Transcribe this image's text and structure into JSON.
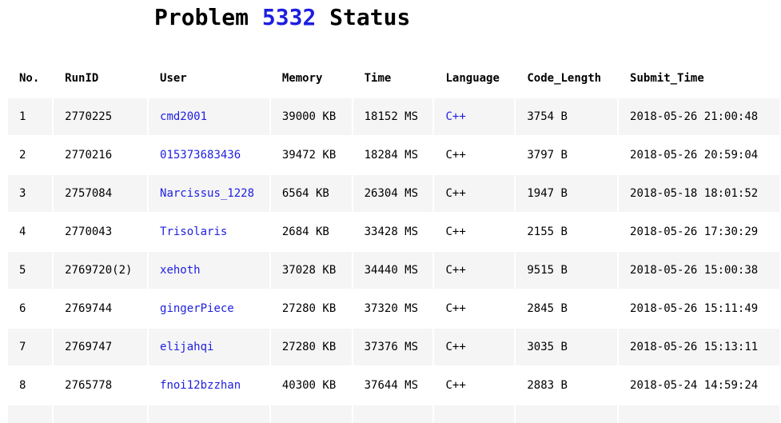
{
  "page": {
    "title_prefix": "Problem",
    "problem_id": "5332",
    "title_suffix": "Status"
  },
  "table": {
    "headers": {
      "no": "No.",
      "run_id": "RunID",
      "user": "User",
      "memory": "Memory",
      "time": "Time",
      "language": "Language",
      "code_length": "Code_Length",
      "submit_time": "Submit_Time"
    },
    "rows": [
      {
        "no": "1",
        "run_id": "2770225",
        "user": "cmd2001",
        "memory": "39000 KB",
        "time": "18152 MS",
        "language": "C++",
        "code_length": "3754 B",
        "submit_time": "2018-05-26 21:00:48"
      },
      {
        "no": "2",
        "run_id": "2770216",
        "user": "015373683436",
        "memory": "39472 KB",
        "time": "18284 MS",
        "language": "C++",
        "code_length": "3797 B",
        "submit_time": "2018-05-26 20:59:04"
      },
      {
        "no": "3",
        "run_id": "2757084",
        "user": "Narcissus_1228",
        "memory": "6564 KB",
        "time": "26304 MS",
        "language": "C++",
        "code_length": "1947 B",
        "submit_time": "2018-05-18 18:01:52"
      },
      {
        "no": "4",
        "run_id": "2770043",
        "user": "Trisolaris",
        "memory": "2684 KB",
        "time": "33428 MS",
        "language": "C++",
        "code_length": "2155 B",
        "submit_time": "2018-05-26 17:30:29"
      },
      {
        "no": "5",
        "run_id": "2769720(2)",
        "user": "xehoth",
        "memory": "37028 KB",
        "time": "34440 MS",
        "language": "C++",
        "code_length": "9515 B",
        "submit_time": "2018-05-26 15:00:38"
      },
      {
        "no": "6",
        "run_id": "2769744",
        "user": "gingerPiece",
        "memory": "27280 KB",
        "time": "37320 MS",
        "language": "C++",
        "code_length": "2845 B",
        "submit_time": "2018-05-26 15:11:49"
      },
      {
        "no": "7",
        "run_id": "2769747",
        "user": "elijahqi",
        "memory": "27280 KB",
        "time": "37376 MS",
        "language": "C++",
        "code_length": "3035 B",
        "submit_time": "2018-05-26 15:13:11"
      },
      {
        "no": "8",
        "run_id": "2765778",
        "user": "fnoi12bzzhan",
        "memory": "40300 KB",
        "time": "37644 MS",
        "language": "C++",
        "code_length": "2883 B",
        "submit_time": "2018-05-24 14:59:24"
      },
      {
        "no": "",
        "run_id": "",
        "user": "",
        "memory": "",
        "time": "",
        "language": "",
        "code_length": "",
        "submit_time": ""
      }
    ],
    "language_link_rows": [
      0
    ]
  },
  "colors": {
    "link": "#1e1ee0",
    "row_shaded": "#f5f5f5",
    "row_plain": "#ffffff"
  }
}
